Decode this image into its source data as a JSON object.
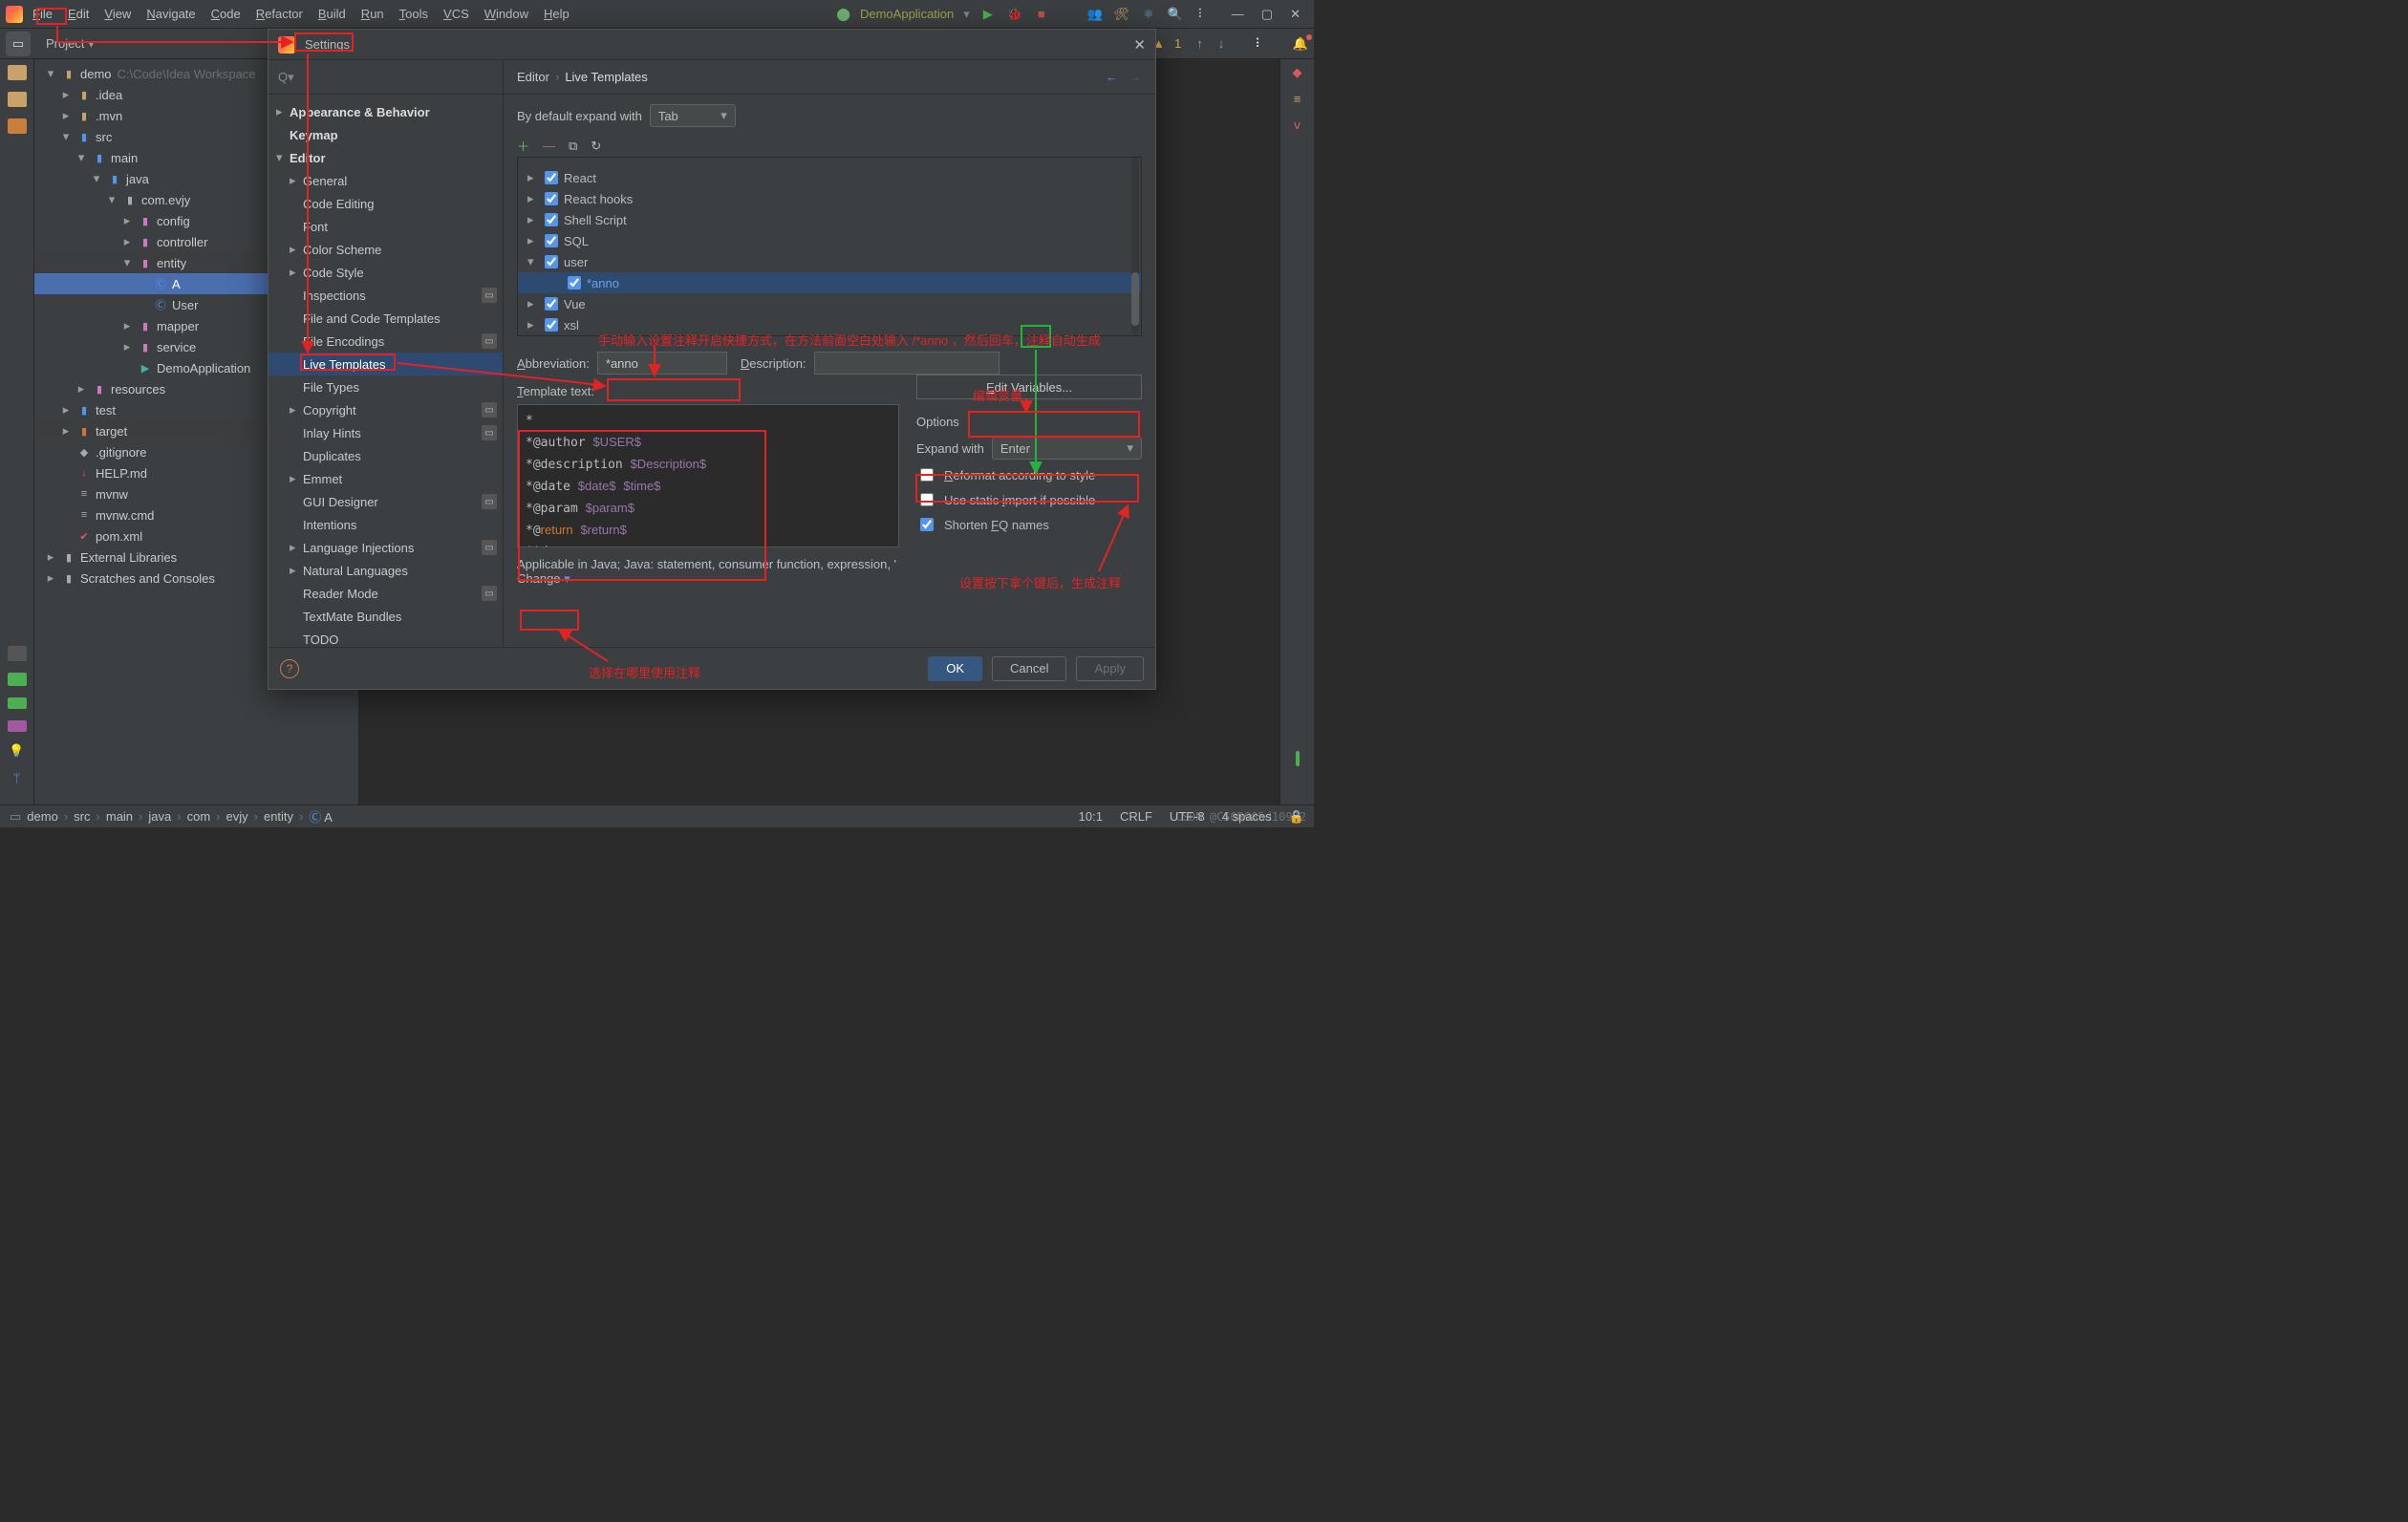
{
  "menu": {
    "items": [
      "File",
      "Edit",
      "View",
      "Navigate",
      "Code",
      "Refactor",
      "Build",
      "Run",
      "Tools",
      "VCS",
      "Window",
      "Help"
    ],
    "runConfig": "DemoApplication"
  },
  "project": {
    "label": "Project"
  },
  "tree": [
    {
      "d": 0,
      "tw": "▾",
      "ic": "i-folder",
      "t": "demo",
      "sub": "C:\\Code\\Idea Workspace"
    },
    {
      "d": 1,
      "tw": "▸",
      "ic": "i-folder",
      "t": ".idea"
    },
    {
      "d": 1,
      "tw": "▸",
      "ic": "i-folder",
      "t": ".mvn"
    },
    {
      "d": 1,
      "tw": "▾",
      "ic": "i-blue",
      "t": "src"
    },
    {
      "d": 2,
      "tw": "▾",
      "ic": "i-blue",
      "t": "main"
    },
    {
      "d": 3,
      "tw": "▾",
      "ic": "i-blue",
      "t": "java"
    },
    {
      "d": 4,
      "tw": "▾",
      "ic": "i-gray",
      "t": "com.evjy"
    },
    {
      "d": 5,
      "tw": "▸",
      "ic": "i-mag",
      "t": "config"
    },
    {
      "d": 5,
      "tw": "▸",
      "ic": "i-mag",
      "t": "controller"
    },
    {
      "d": 5,
      "tw": "▾",
      "ic": "i-mag",
      "t": "entity",
      "dim": true
    },
    {
      "d": 6,
      "tw": "",
      "ic": "i-blue",
      "t": "A",
      "sel": true,
      "iconChar": "Ⓒ"
    },
    {
      "d": 6,
      "tw": "",
      "ic": "i-blue",
      "t": "User",
      "iconChar": "Ⓒ"
    },
    {
      "d": 5,
      "tw": "▸",
      "ic": "i-mag",
      "t": "mapper"
    },
    {
      "d": 5,
      "tw": "▸",
      "ic": "i-mag",
      "t": "service"
    },
    {
      "d": 5,
      "tw": "",
      "ic": "i-teal",
      "t": "DemoApplication",
      "iconChar": "▶"
    },
    {
      "d": 2,
      "tw": "▸",
      "ic": "i-mag",
      "t": "resources"
    },
    {
      "d": 1,
      "tw": "▸",
      "ic": "i-blue",
      "t": "test"
    },
    {
      "d": 1,
      "tw": "▸",
      "ic": "i-orange",
      "t": "target",
      "dim": true
    },
    {
      "d": 1,
      "tw": "",
      "ic": "i-gray",
      "t": ".gitignore",
      "iconChar": "◆"
    },
    {
      "d": 1,
      "tw": "",
      "ic": "i-red",
      "t": "HELP.md",
      "iconChar": "↓"
    },
    {
      "d": 1,
      "tw": "",
      "ic": "i-gray",
      "t": "mvnw",
      "iconChar": "≡"
    },
    {
      "d": 1,
      "tw": "",
      "ic": "i-gray",
      "t": "mvnw.cmd",
      "iconChar": "≡"
    },
    {
      "d": 1,
      "tw": "",
      "ic": "i-red",
      "t": "pom.xml",
      "iconChar": "✔"
    },
    {
      "d": 0,
      "tw": "▸",
      "ic": "i-gray",
      "t": "External Libraries"
    },
    {
      "d": 0,
      "tw": "▸",
      "ic": "i-gray",
      "t": "Scratches and Consoles"
    }
  ],
  "dialog": {
    "title": "Settings",
    "search": "",
    "left": [
      {
        "lv": 1,
        "tw": "▸",
        "t": "Appearance & Behavior",
        "bold": true
      },
      {
        "lv": 1,
        "tw": "",
        "t": "Keymap",
        "bold": true
      },
      {
        "lv": 1,
        "tw": "▾",
        "t": "Editor",
        "bold": true
      },
      {
        "lv": 2,
        "tw": "▸",
        "t": "General"
      },
      {
        "lv": 2,
        "tw": "",
        "t": "Code Editing"
      },
      {
        "lv": 2,
        "tw": "",
        "t": "Font"
      },
      {
        "lv": 2,
        "tw": "▸",
        "t": "Color Scheme"
      },
      {
        "lv": 2,
        "tw": "▸",
        "t": "Code Style"
      },
      {
        "lv": 2,
        "tw": "",
        "t": "Inspections",
        "badge": "▭"
      },
      {
        "lv": 2,
        "tw": "",
        "t": "File and Code Templates"
      },
      {
        "lv": 2,
        "tw": "",
        "t": "File Encodings",
        "badge": "▭"
      },
      {
        "lv": 2,
        "tw": "",
        "t": "Live Templates",
        "sel": true
      },
      {
        "lv": 2,
        "tw": "",
        "t": "File Types"
      },
      {
        "lv": 2,
        "tw": "▸",
        "t": "Copyright",
        "badge": "▭"
      },
      {
        "lv": 2,
        "tw": "",
        "t": "Inlay Hints",
        "badge": "▭"
      },
      {
        "lv": 2,
        "tw": "",
        "t": "Duplicates"
      },
      {
        "lv": 2,
        "tw": "▸",
        "t": "Emmet"
      },
      {
        "lv": 2,
        "tw": "",
        "t": "GUI Designer",
        "badge": "▭"
      },
      {
        "lv": 2,
        "tw": "",
        "t": "Intentions"
      },
      {
        "lv": 2,
        "tw": "▸",
        "t": "Language Injections",
        "badge": "▭"
      },
      {
        "lv": 2,
        "tw": "▸",
        "t": "Natural Languages"
      },
      {
        "lv": 2,
        "tw": "",
        "t": "Reader Mode",
        "badge": "▭"
      },
      {
        "lv": 2,
        "tw": "",
        "t": "TextMate Bundles"
      },
      {
        "lv": 2,
        "tw": "",
        "t": "TODO"
      }
    ],
    "breadcrumb": [
      "Editor",
      "Live Templates"
    ],
    "defaultExpandLabel": "By default expand with",
    "defaultExpand": "Tab",
    "groups": [
      {
        "tw": "▸",
        "t": "React"
      },
      {
        "tw": "▸",
        "t": "React hooks"
      },
      {
        "tw": "▸",
        "t": "Shell Script"
      },
      {
        "tw": "▸",
        "t": "SQL"
      },
      {
        "tw": "▾",
        "t": "user",
        "children": [
          {
            "t": "*anno",
            "sel": true
          }
        ]
      },
      {
        "tw": "▸",
        "t": "Vue"
      },
      {
        "tw": "▸",
        "t": "xsl"
      }
    ],
    "abbrevLabel": "Abbreviation:",
    "abbrev": "*anno",
    "descLabel": "Description:",
    "desc": "",
    "templateTextLabel": "Template text:",
    "templateLines": [
      {
        "seg": [
          {
            "t": "*"
          }
        ]
      },
      {
        "seg": [
          {
            "t": "*@author "
          },
          {
            "t": "$USER$",
            "c": "var"
          }
        ]
      },
      {
        "seg": [
          {
            "t": "*@description "
          },
          {
            "t": "$Description$",
            "c": "var"
          }
        ]
      },
      {
        "seg": [
          {
            "t": "*@date "
          },
          {
            "t": "$date$",
            "c": "var"
          },
          {
            "t": " "
          },
          {
            "t": "$time$",
            "c": "var"
          }
        ]
      },
      {
        "seg": [
          {
            "t": "*@param "
          },
          {
            "t": "$param$",
            "c": "var"
          }
        ]
      },
      {
        "seg": [
          {
            "t": "*@"
          },
          {
            "t": "return",
            "c": "kw"
          },
          {
            "t": " "
          },
          {
            "t": "$return$",
            "c": "var"
          }
        ]
      },
      {
        "seg": [
          {
            "t": "**/"
          }
        ]
      }
    ],
    "editVars": "Edit Variables...",
    "optionsLabel": "Options",
    "expandWithLabel": "Expand with",
    "expandWith": "Enter",
    "optReformat": "Reformat according to style",
    "optStatic": "Use static import if possible",
    "optShorten": "Shorten FQ names",
    "applicable": "Applicable in Java; Java: statement, consumer function, expression, '",
    "change": "Change",
    "ok": "OK",
    "cancel": "Cancel",
    "apply": "Apply"
  },
  "statusbar": {
    "crumbs": [
      "demo",
      "src",
      "main",
      "java",
      "com",
      "evjy",
      "entity",
      "A"
    ],
    "pos": "10:1",
    "eol": "CRLF",
    "enc": "UTF-8",
    "indent": "4 spaces"
  },
  "ann": {
    "tip1": "手动输入设置注释开启快捷方式，在方法前面空白处输入 /*anno ，然后回车，注释自动生成",
    "editVar": "编辑变量",
    "setKey": "设置按下拿个键后，生成注释",
    "whereUse": "选择在哪里使用注释"
  },
  "topRight": {
    "warn": "1"
  },
  "watermark": "CSDN @CSQR985d109B2"
}
